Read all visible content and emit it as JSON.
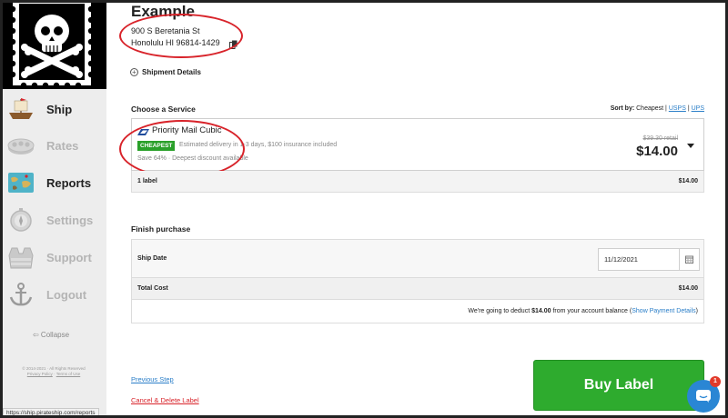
{
  "sidebar": {
    "nav": [
      {
        "label": "Ship",
        "icon": "ship-icon"
      },
      {
        "label": "Rates",
        "icon": "rates-icon"
      },
      {
        "label": "Reports",
        "icon": "reports-map-icon"
      },
      {
        "label": "Settings",
        "icon": "settings-compass-icon"
      },
      {
        "label": "Support",
        "icon": "support-vest-icon"
      },
      {
        "label": "Logout",
        "icon": "logout-anchor-icon"
      }
    ],
    "collapse_label": "⇦ Collapse",
    "copyright": "© 2014-2021 · All Rights Reserved",
    "privacy_label": "Privacy Policy",
    "terms_label": "Terms of Use"
  },
  "shipment": {
    "title": "Example",
    "address_line1": "900 S Beretania St",
    "address_line2": "Honolulu HI 96814-1429",
    "details_label": "Shipment Details"
  },
  "service": {
    "heading": "Choose a Service",
    "sort_label": "Sort by:",
    "sort_current": "Cheapest",
    "sort_options": [
      "USPS",
      "UPS"
    ],
    "name": "Priority Mail Cubic",
    "badge": "CHEAPEST",
    "description": "Estimated delivery in 1-3 days, $100 insurance included",
    "savings": "Save 64% · Deepest discount available",
    "retail_price": "$39.30 retail",
    "price": "$14.00",
    "labels_count": "1 label",
    "labels_total": "$14.00"
  },
  "purchase": {
    "heading": "Finish purchase",
    "ship_date_label": "Ship Date",
    "ship_date_value": "11/12/2021",
    "total_label": "Total Cost",
    "total_value": "$14.00",
    "deduct_prefix": "We're going to deduct ",
    "deduct_amount": "$14.00",
    "deduct_middle": " from your account balance (",
    "deduct_link": "Show Payment Details",
    "deduct_suffix": ")"
  },
  "actions": {
    "previous_step": "Previous Step",
    "cancel_delete": "Cancel & Delete Label",
    "buy_label": "Buy Label"
  },
  "chat": {
    "badge_count": "1"
  },
  "status_bar": {
    "url": "https://ship.pirateship.com/reports"
  },
  "colors": {
    "accent_green": "#2eab2e",
    "link_blue": "#2a7ec8",
    "annotation_red": "#d8232a"
  }
}
